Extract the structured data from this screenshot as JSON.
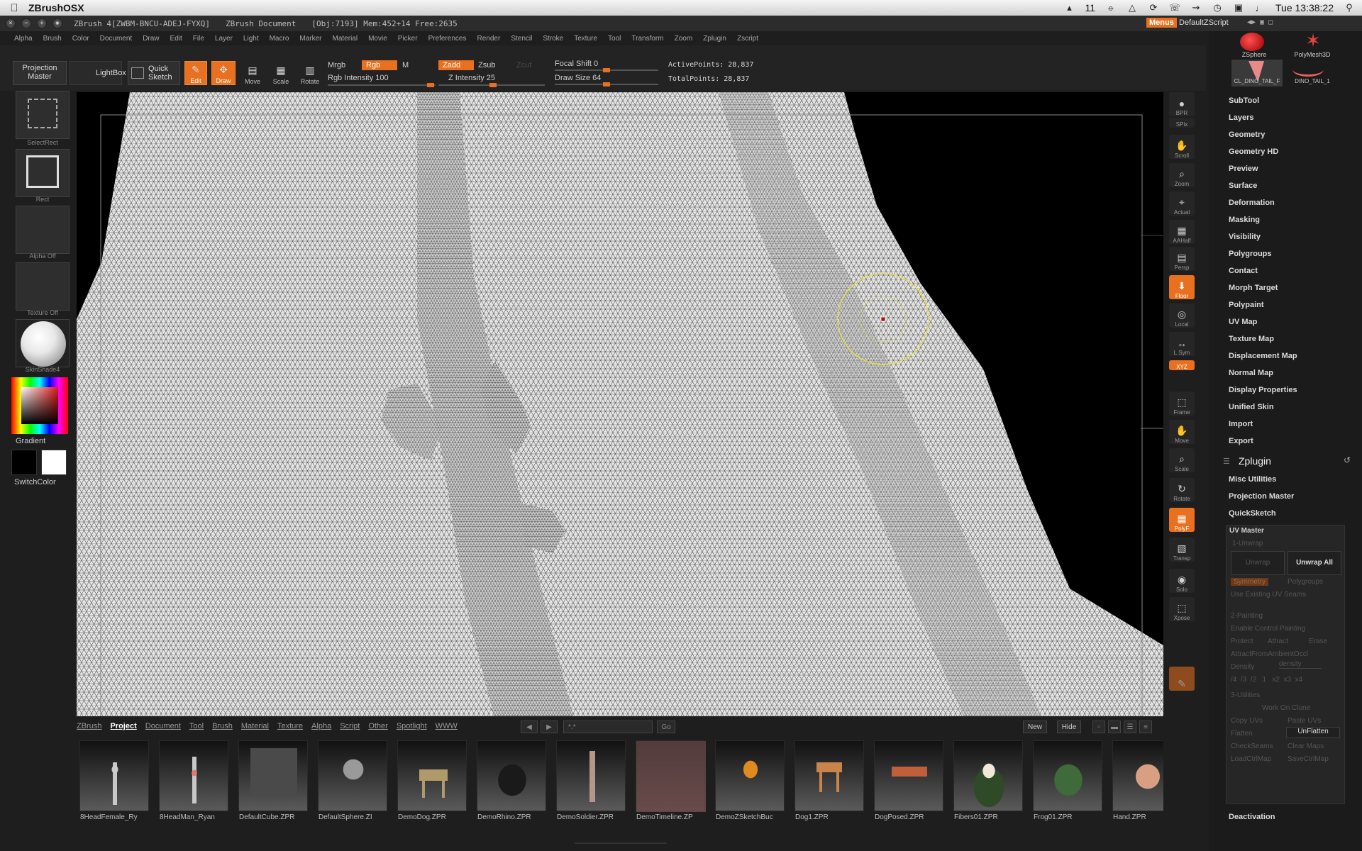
{
  "os": {
    "app_name": "ZBrushOSX",
    "clock": "Tue 13:38:22",
    "status_number": "11"
  },
  "titlebar": {
    "title": "ZBrush 4[ZWBM-BNCU-ADEJ-FYXQ]",
    "document": "ZBrush Document",
    "stats": "[Obj:7193] Mem:452+14 Free:2635",
    "menus": "Menus",
    "script": "DefaultZScript"
  },
  "menu": [
    "Alpha",
    "Brush",
    "Color",
    "Document",
    "Draw",
    "Edit",
    "File",
    "Layer",
    "Light",
    "Macro",
    "Marker",
    "Material",
    "Movie",
    "Picker",
    "Preferences",
    "Render",
    "Stencil",
    "Stroke",
    "Texture",
    "Tool",
    "Transform",
    "Zoom",
    "Zplugin",
    "Zscript"
  ],
  "toolbar": {
    "projection_master": "Projection Master",
    "lightbox": "LightBox",
    "quick_sketch": "Quick Sketch",
    "edit": "Edit",
    "draw": "Draw",
    "move": "Move",
    "scale": "Scale",
    "rotate": "Rotate",
    "mrgb": "Mrgb",
    "rgb": "Rgb",
    "m": "M",
    "rgb_intensity": "Rgb Intensity 100",
    "zadd": "Zadd",
    "zsub": "Zsub",
    "zcut": "Zcut",
    "z_intensity": "Z Intensity 25",
    "focal_shift": "Focal Shift 0",
    "draw_size": "Draw Size 64",
    "active_points": "ActivePoints: 28,837",
    "total_points": "TotalPoints: 28,837"
  },
  "leftshelf": {
    "select_rect": "SelectRect",
    "rect": "Rect",
    "alpha_off": "Alpha Off",
    "texture_off": "Texture Off",
    "material": "SkinShade4",
    "gradient": "Gradient",
    "switch_color": "SwitchColor"
  },
  "rightshelf": [
    "BPR",
    "SPix",
    "Scroll",
    "Zoom",
    "Actual",
    "AAHalf",
    "Persp",
    "Floor",
    "Local",
    "L.Sym",
    "XYZ",
    "Frame",
    "Move",
    "Scale",
    "Rotate",
    "PolyF",
    "Transp",
    "Solo",
    "Xpose"
  ],
  "subtools": {
    "a": "ZSphere",
    "b": "PolyMesh3D",
    "c": "CL_DINO_TAIL_F",
    "d": "DINO_TAIL_1"
  },
  "palette": [
    "SubTool",
    "Layers",
    "Geometry",
    "Geometry HD",
    "Preview",
    "Surface",
    "Deformation",
    "Masking",
    "Visibility",
    "Polygroups",
    "Contact",
    "Morph Target",
    "Polypaint",
    "UV Map",
    "Texture Map",
    "Displacement Map",
    "Normal Map",
    "Display Properties",
    "Unified Skin",
    "Import",
    "Export"
  ],
  "zplugin": {
    "title": "Zplugin",
    "items": [
      "Misc Utilities",
      "Projection Master",
      "QuickSketch"
    ],
    "uv_master": "UV Master",
    "unwrap_section": "1-Unwrap",
    "unwrap": "Unwrap",
    "unwrap_all": "Unwrap All",
    "symmetry": "Symmetry",
    "polygroups": "Polygroups",
    "use_existing": "Use Existing UV Seams",
    "painting_section": "2-Painting",
    "enable_control": "Enable Control Painting",
    "protect": "Protect",
    "attract": "Attract",
    "erase": "Erase",
    "attract_ao": "AttractFromAmbientOccl",
    "density": "Density",
    "density_value": "density",
    "utilities_section": "3-Utilities",
    "work_on_clone": "Work On Clone",
    "copy_uvs": "Copy UVs",
    "paste_uvs": "Paste UVs",
    "flatten": "Flatten",
    "unflatten": "UnFlatten",
    "check_seams": "CheckSeams",
    "clear_maps": "Clear Maps",
    "load_ctrl_map": "LoadCtrlMap",
    "save_ctrl_map": "SaveCtrlMap",
    "deactivation": "Deactivation"
  },
  "browser": {
    "tabs": [
      "ZBrush",
      "Project",
      "Document",
      "Tool",
      "Brush",
      "Material",
      "Texture",
      "Alpha",
      "Script",
      "Other",
      "Spotlight",
      "WWW"
    ],
    "active_tab": "Project",
    "filter": "*.*",
    "go": "Go",
    "new": "New",
    "hide": "Hide",
    "files": [
      "8HeadFemale_Ry",
      "8HeadMan_Ryan",
      "DefaultCube.ZPR",
      "DefaultSphere.ZI",
      "DemoDog.ZPR",
      "DemoRhino.ZPR",
      "DemoSoldier.ZPR",
      "DemoTimeline.ZP",
      "DemoZSketchBuc",
      "Dog1.ZPR",
      "DogPosed.ZPR",
      "Fibers01.ZPR",
      "Frog01.ZPR",
      "Hand.ZPR"
    ]
  },
  "colors": {
    "accent": "#e8701f",
    "mesh_fill": "#e6e6e6",
    "mesh_line": "#4a4a4a"
  }
}
